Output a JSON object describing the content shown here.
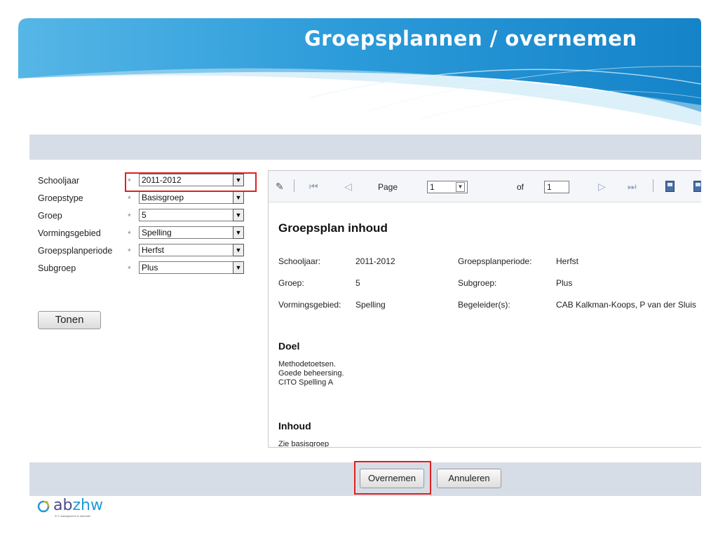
{
  "slide": {
    "title": "Groepsplannen / overnemen"
  },
  "form": {
    "fields": [
      {
        "label": "Schooljaar",
        "value": "2011-2012"
      },
      {
        "label": "Groepstype",
        "value": "Basisgroep"
      },
      {
        "label": "Groep",
        "value": "5"
      },
      {
        "label": "Vormingsgebied",
        "value": "Spelling"
      },
      {
        "label": "Groepsplanperiode",
        "value": "Herfst"
      },
      {
        "label": "Subgroep",
        "value": "Plus"
      }
    ],
    "required_mark": "*",
    "tonen_label": "Tonen"
  },
  "viewer": {
    "toolbar": {
      "page_label": "Page",
      "page_value": "1",
      "of_label": "of",
      "total_value": "1"
    },
    "report": {
      "title": "Groepsplan inhoud",
      "left": [
        {
          "key": "Schooljaar:",
          "value": "2011-2012"
        },
        {
          "key": "Groep:",
          "value": "5"
        },
        {
          "key": "Vormingsgebied:",
          "value": "Spelling"
        }
      ],
      "right": [
        {
          "key": "Groepsplanperiode:",
          "value": "Herfst"
        },
        {
          "key": "Subgroep:",
          "value": "Plus"
        },
        {
          "key": "Begeleider(s):",
          "value": "CAB  Kalkman-Koops, P van der Sluis"
        }
      ],
      "doel_heading": "Doel",
      "doel_lines": [
        "Methodetoetsen.",
        "Goede beheersing.",
        "CITO Spelling A"
      ],
      "inhoud_heading": "Inhoud",
      "inhoud_line": "Zie basisgroep"
    }
  },
  "actions": {
    "overnemen_label": "Overnemen",
    "annuleren_label": "Annuleren"
  },
  "logo": {
    "main": "ab",
    "accent": "zhw",
    "tagline": "ICT management & educatie"
  },
  "colors": {
    "banner": "#1e8fd0",
    "highlight": "#e02020",
    "bar": "#d7dde6"
  }
}
